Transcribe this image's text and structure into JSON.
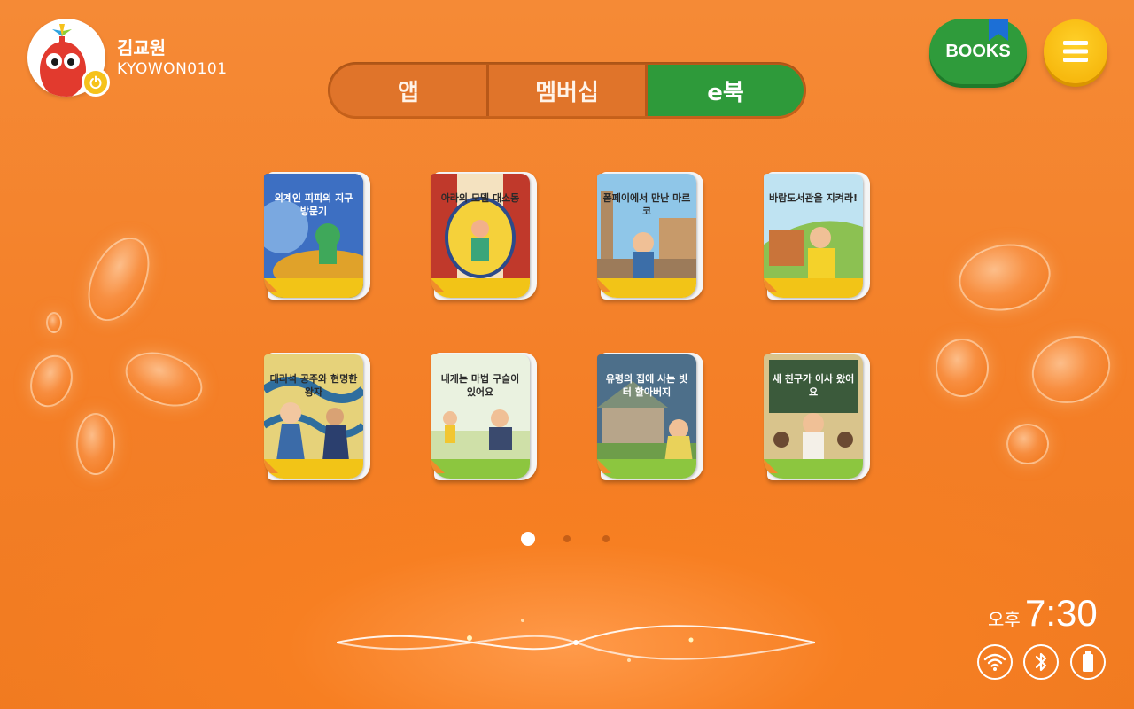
{
  "profile": {
    "name": "김교원",
    "user_id": "KYOWON0101"
  },
  "tabs": [
    {
      "label": "앱",
      "active": false
    },
    {
      "label": "멤버십",
      "active": false
    },
    {
      "label": "e북",
      "active": true
    }
  ],
  "header_buttons": {
    "books_label": "BOOKS",
    "menu_icon": "hamburger-icon"
  },
  "books": [
    {
      "title": "외계인 피피의 지구 방문기"
    },
    {
      "title": "아라의 모델 대소동"
    },
    {
      "title": "폼페이에서 만난 마르코"
    },
    {
      "title": "바람도서관을 지켜라!"
    },
    {
      "title": "대리석 공주와 현명한 왕자"
    },
    {
      "title": "내게는 마법 구슬이 있어요"
    },
    {
      "title": "유령의 집에 사는 빗터 할아버지"
    },
    {
      "title": "새 친구가 이사 왔어요"
    }
  ],
  "pager": {
    "pages": 3,
    "current": 1
  },
  "status_bar": {
    "ampm": "오후",
    "time": "7:30",
    "icons": [
      "wifi-icon",
      "bluetooth-icon",
      "battery-icon"
    ]
  },
  "colors": {
    "background": "#f47f27",
    "active_tab": "#2e9a3a",
    "books_button": "#2f9b3b",
    "menu_button": "#f7b90f"
  }
}
